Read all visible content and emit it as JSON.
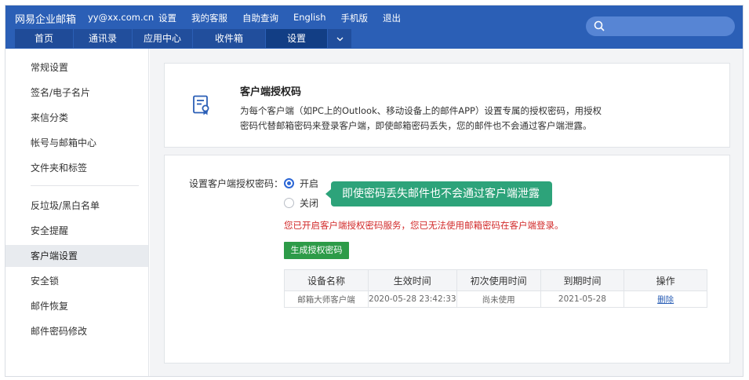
{
  "header": {
    "logo": "网易企业邮箱",
    "user_email": "yy@xx.com.cn",
    "top_links": [
      "设置",
      "我的客服",
      "自助查询",
      "English",
      "手机版",
      "退出"
    ],
    "tabs": [
      "首页",
      "通讯录",
      "应用中心",
      "收件箱",
      "设置"
    ],
    "active_tab": "设置",
    "search_placeholder": ""
  },
  "sidebar": {
    "items": [
      "常规设置",
      "签名/电子名片",
      "来信分类",
      "帐号与邮箱中心",
      "文件夹和标签",
      "反垃圾/黑白名单",
      "安全提醒",
      "客户端设置",
      "安全锁",
      "邮件恢复",
      "邮件密码修改"
    ],
    "active": "客户端设置"
  },
  "intro": {
    "title": "客户端授权码",
    "description_line1": "为每个客户端（如PC上的Outlook、移动设备上的邮件APP）设置专属的授权密码，用授权",
    "description_line2": "密码代替邮箱密码来登录客户端，即使邮箱密码丢失，您的邮件也不会通过客户端泄露。"
  },
  "settings": {
    "label": "设置客户端授权密码：",
    "option_on": "开启",
    "option_off": "关闭",
    "selected": "开启",
    "tooltip": "即使密码丢失邮件也不会通过客户端泄露",
    "warning": "您已开启客户端授权密码服务，您已无法使用邮箱密码在客户端登录。",
    "generate_button": "生成授权密码"
  },
  "table": {
    "columns": [
      "设备名称",
      "生效时间",
      "初次使用时间",
      "到期时间",
      "操作"
    ],
    "rows": [
      [
        "邮箱大师客户端",
        "2020-05-28 23:42:33",
        "尚未使用",
        "2021-05-28",
        "删除"
      ]
    ]
  },
  "colors": {
    "header": "#2b5fb6",
    "tooltip": "#2da37a",
    "warning": "#d22b2b",
    "button": "#2d9b48"
  }
}
